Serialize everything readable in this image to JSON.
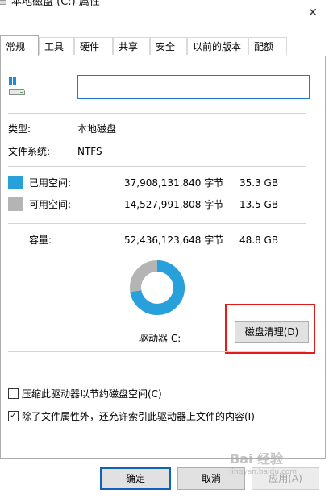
{
  "window": {
    "title": "本地磁盘 (C:) 属性",
    "close_glyph": "✕"
  },
  "tabs": [
    {
      "label": "常规",
      "active": true
    },
    {
      "label": "工具"
    },
    {
      "label": "硬件"
    },
    {
      "label": "共享"
    },
    {
      "label": "安全"
    },
    {
      "label": "以前的版本"
    },
    {
      "label": "配额"
    }
  ],
  "general": {
    "name_value": "",
    "type_label": "类型:",
    "type_value": "本地磁盘",
    "fs_label": "文件系统:",
    "fs_value": "NTFS",
    "used": {
      "label": "已用空间:",
      "bytes": "37,908,131,840 字节",
      "gb": "35.3 GB",
      "color": "#27a0db"
    },
    "free": {
      "label": "可用空间:",
      "bytes": "14,527,991,808 字节",
      "gb": "13.5 GB",
      "color": "#b4b4b4"
    },
    "capacity": {
      "label": "容量:",
      "bytes": "52,436,123,648 字节",
      "gb": "48.8 GB"
    },
    "used_fraction": 0.723,
    "drive_label": "驱动器 C:",
    "cleanup_button": "磁盘清理(D)",
    "compress_label": "压缩此驱动器以节约磁盘空间(C)",
    "compress_checked": false,
    "index_label": "除了文件属性外，还允许索引此驱动器上文件的内容(I)",
    "index_checked": true
  },
  "buttons": {
    "ok": "确定",
    "cancel": "取消",
    "apply": "应用(A)"
  },
  "highlight_color": "#e31b1b",
  "watermark": {
    "text": "Bai 经验",
    "sub": "jingyan.baidu.com"
  }
}
